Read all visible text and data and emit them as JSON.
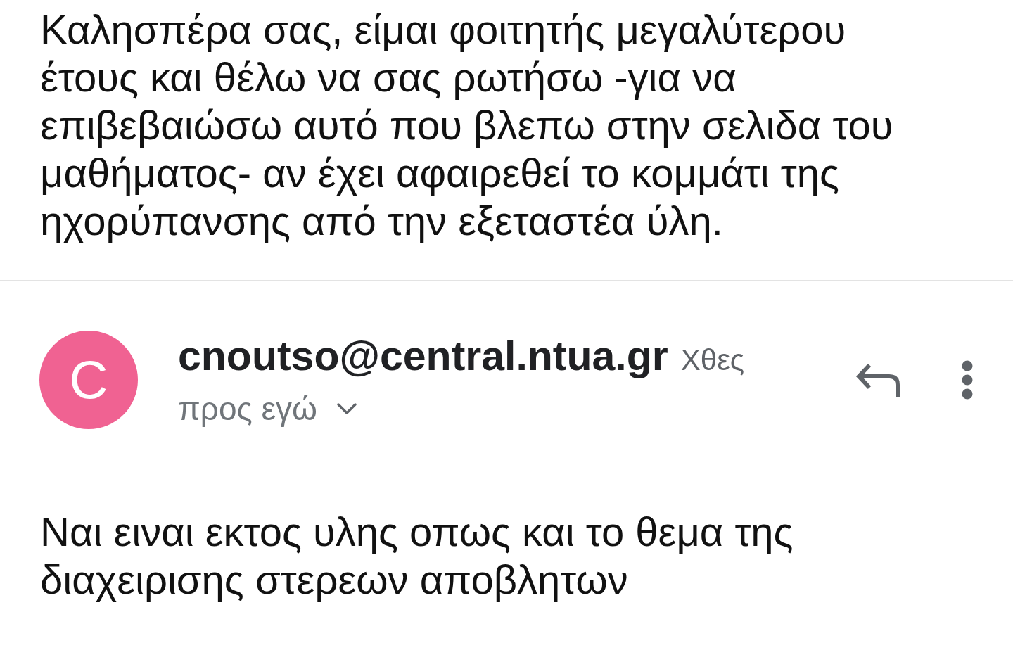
{
  "quoted_message": {
    "text": "Καλησπέρα σας, είμαι φοιτητής μεγαλύτερου έτους και θέλω να σας ρωτήσω -για να επιβεβαιώσω αυτό που βλεπω στην σελιδα του μαθήματος- αν έχει αφαιρεθεί το κομμάτι της ηχορύπανσης από την εξεταστέα ύλη."
  },
  "message": {
    "avatar_letter": "C",
    "sender": "cnoutso@central.ntua.gr",
    "time": "Χθες",
    "recipients": "προς εγώ",
    "details_expanded": false,
    "body": "Ναι ειναι εκτος υλης οπως και το θεμα της διαχειρισης στερεων αποβλητων"
  }
}
